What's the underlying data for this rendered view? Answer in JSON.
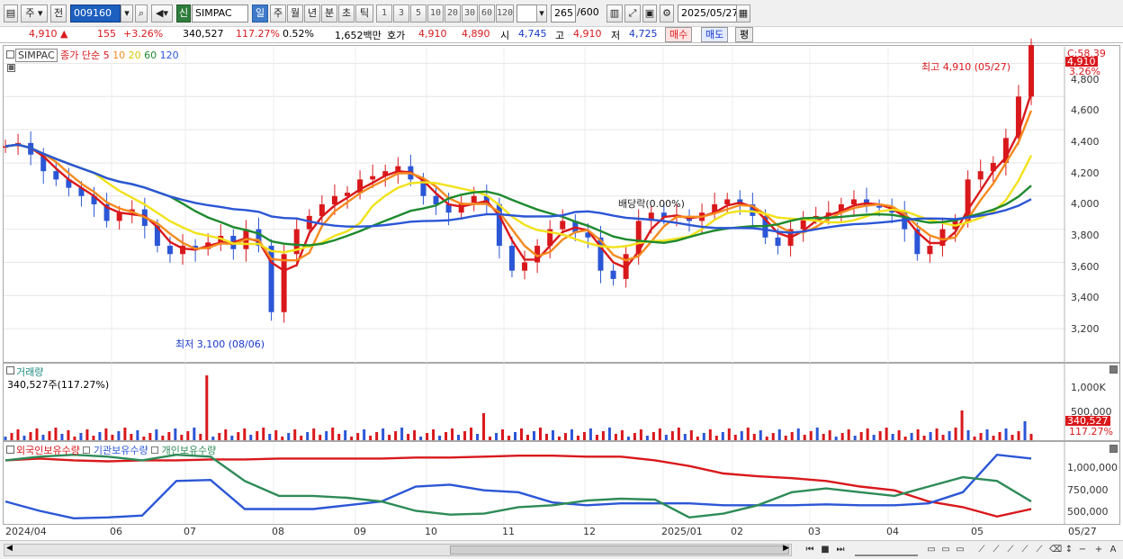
{
  "toolbar": {
    "market": "주",
    "prev_label": "전",
    "code": "009160",
    "name": "SIMPAC",
    "market_badge": "신",
    "periods": [
      "일",
      "주",
      "월",
      "년",
      "분",
      "초",
      "틱"
    ],
    "active_period": "일",
    "intervals": [
      "1",
      "3",
      "5",
      "10",
      "20",
      "30",
      "60",
      "120"
    ],
    "count": "265",
    "count_max": "/600",
    "date": "2025/05/27"
  },
  "quote": {
    "price": "4,910",
    "arrow": "▲",
    "change": "155",
    "change_pct": "+3.26%",
    "volume": "340,527",
    "volume_ratio": "117.27%",
    "turnover": "0.52%",
    "amount": "1,652백만",
    "bid_label": "호가",
    "ask": "4,910",
    "bid": "4,890",
    "open_label": "시",
    "open": "4,745",
    "high_label": "고",
    "high": "4,910",
    "low_label": "저",
    "low": "4,725",
    "buy_button": "매수",
    "sell_button": "매도",
    "eval_button": "평"
  },
  "price_pane": {
    "legend_name": "SIMPAC",
    "legend_ma": "종가 단순",
    "ma_periods": [
      "5",
      "10",
      "20",
      "60",
      "120"
    ],
    "ma_colors": [
      "#d9181c",
      "#f58a1e",
      "#f2e21b",
      "#1e8a2e",
      "#2b56d6"
    ],
    "y_ticks": [
      "4,600",
      "4,400",
      "4,200",
      "4,000",
      "3,800",
      "3,600",
      "3,400",
      "3,200"
    ],
    "top_tick": "4,800",
    "corner_value": "C:58.39",
    "last_price_tag": "4,910",
    "last_change_tag": "3.26%",
    "high_annotation": "최고 4,910 (05/27)",
    "low_annotation": "최저 3,100 (08/06)",
    "dividend_annotation": "배당락(0.00%)"
  },
  "volume_pane": {
    "title": "거래량",
    "value": "340,527주(117.27%)",
    "y_ticks": [
      "1,000K",
      "500,000"
    ],
    "last_tag": "340,527",
    "last_pct_tag": "117.27%"
  },
  "holdings_pane": {
    "legends": [
      "외국인보유수량",
      "기관보유수량",
      "개인보유수량"
    ],
    "colors": [
      "#d9181c",
      "#2b56d6",
      "#2e8b57"
    ],
    "y_ticks": [
      "1,000,000",
      "750,000",
      "500,000"
    ]
  },
  "x_axis": {
    "labels": [
      "2024/04",
      "06",
      "07",
      "08",
      "09",
      "10",
      "11",
      "12",
      "2025/01",
      "02",
      "03",
      "04",
      "05"
    ],
    "last_date": "05/27"
  },
  "chart_data": {
    "type": "candlestick",
    "y_range": [
      3000,
      4900
    ],
    "ohlc_note": "approximate closes read from chart",
    "closes": [
      4300,
      4320,
      4250,
      4150,
      4100,
      4050,
      4000,
      3950,
      3850,
      3900,
      3920,
      3820,
      3700,
      3650,
      3700,
      3680,
      3720,
      3760,
      3680,
      3800,
      3700,
      3300,
      3650,
      3800,
      3880,
      3950,
      4000,
      4020,
      4100,
      4120,
      4150,
      4180,
      4100,
      4000,
      3950,
      3900,
      3960,
      4000,
      3950,
      3700,
      3550,
      3600,
      3700,
      3800,
      3850,
      3780,
      3750,
      3550,
      3500,
      3650,
      3850,
      3900,
      3870,
      3880,
      3850,
      3900,
      3950,
      3980,
      3950,
      3880,
      3750,
      3700,
      3800,
      3870,
      3880,
      3900,
      3950,
      3980,
      3940,
      3930,
      3900,
      3800,
      3650,
      3700,
      3800,
      3850,
      4100,
      4150,
      4200,
      4350,
      4600,
      4910
    ],
    "volume_ratio_peaks": "max ~1,250K in early Jun-2024, recent 340,527"
  }
}
